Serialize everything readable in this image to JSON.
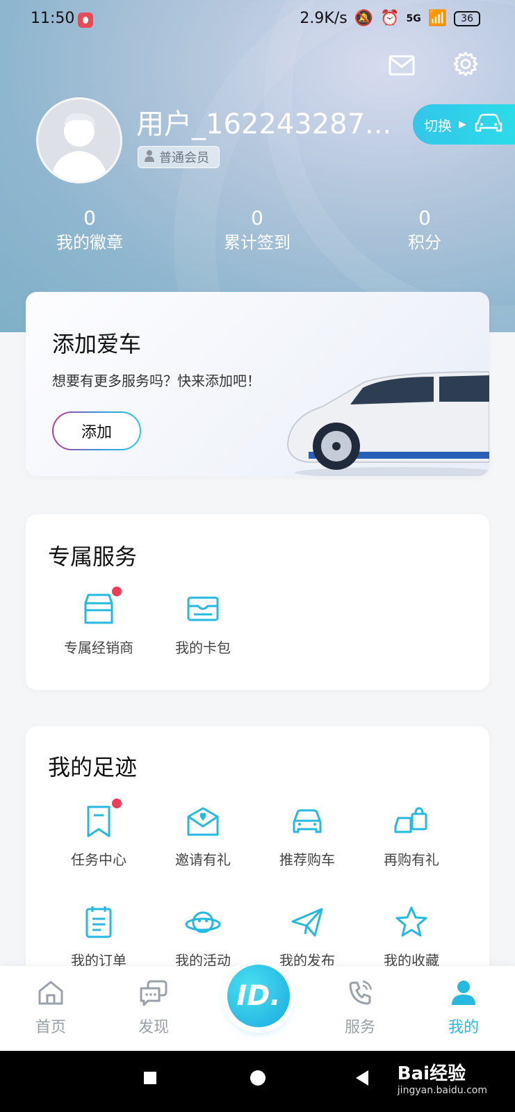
{
  "status_bar": {
    "time": "11:50",
    "speed": "2.9K/s",
    "battery": "36",
    "network": "5G"
  },
  "header": {
    "username": "用户_162243287...",
    "member_level": "普通会员",
    "switch_label": "切换"
  },
  "stats": [
    {
      "value": "0",
      "label": "我的徽章"
    },
    {
      "value": "0",
      "label": "累计签到"
    },
    {
      "value": "0",
      "label": "积分"
    }
  ],
  "car_card": {
    "title": "添加爱车",
    "subtitle": "想要有更多服务吗？快来添加吧！",
    "button": "添加"
  },
  "exclusive": {
    "title": "专属服务",
    "items": [
      {
        "label": "专属经销商",
        "icon": "store-icon",
        "badge": true
      },
      {
        "label": "我的卡包",
        "icon": "card-icon",
        "badge": false
      }
    ]
  },
  "footprint": {
    "title": "我的足迹",
    "items": [
      {
        "label": "任务中心",
        "icon": "bookmark-icon",
        "badge": true
      },
      {
        "label": "邀请有礼",
        "icon": "envelope-heart-icon",
        "badge": false
      },
      {
        "label": "推荐购车",
        "icon": "car-icon",
        "badge": false
      },
      {
        "label": "再购有礼",
        "icon": "car-bag-icon",
        "badge": false
      },
      {
        "label": "我的订单",
        "icon": "clipboard-icon",
        "badge": false
      },
      {
        "label": "我的活动",
        "icon": "planet-icon",
        "badge": false
      },
      {
        "label": "我的发布",
        "icon": "paper-plane-icon",
        "badge": false
      },
      {
        "label": "我的收藏",
        "icon": "star-icon",
        "badge": false
      }
    ]
  },
  "bottom_nav": {
    "items": [
      {
        "label": "首页",
        "icon": "home-icon"
      },
      {
        "label": "发现",
        "icon": "chat-icon"
      },
      {
        "label": "服务",
        "icon": "phone-icon"
      },
      {
        "label": "我的",
        "icon": "user-icon",
        "active": true
      }
    ],
    "center_label": "ID."
  },
  "watermark": {
    "brand": "Bai经验",
    "url": "jingyan.baidu.com"
  },
  "colors": {
    "accent": "#25b9e0",
    "badge": "#f23c56"
  }
}
